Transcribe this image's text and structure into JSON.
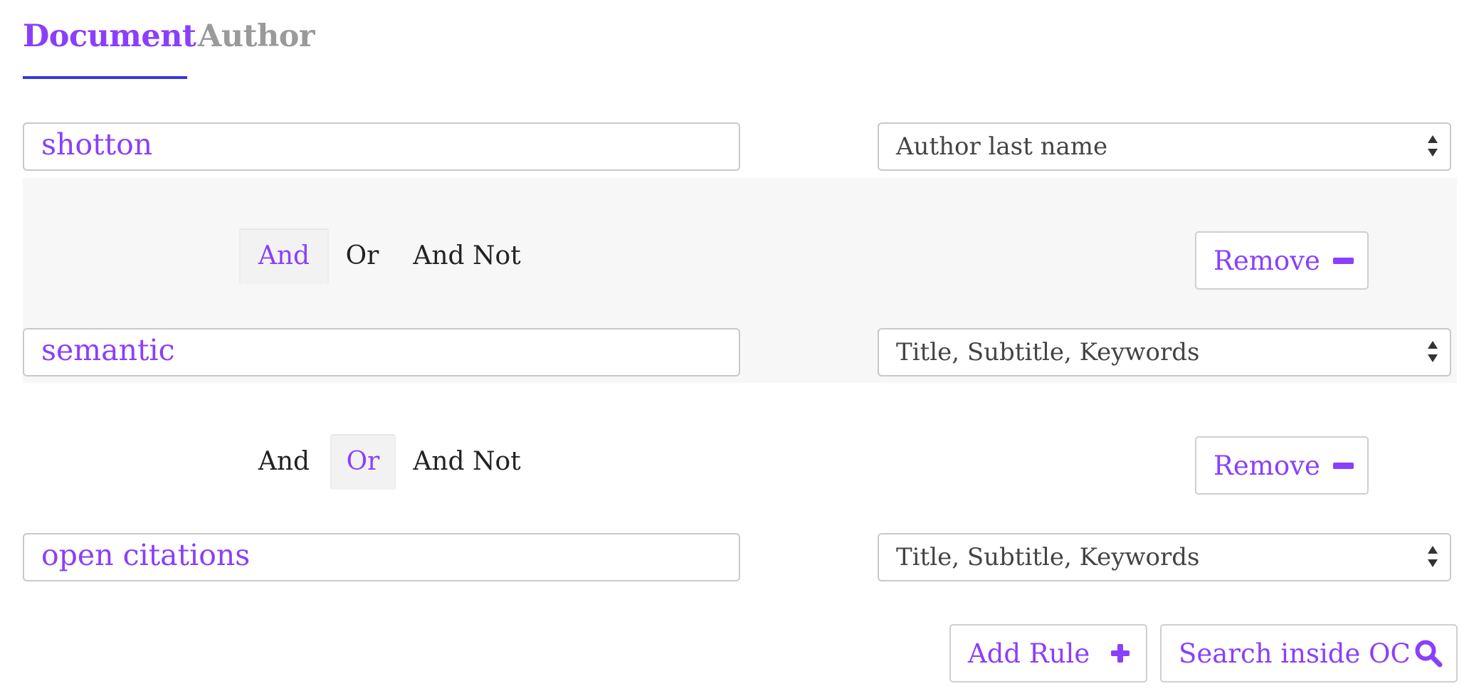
{
  "tabs": [
    {
      "label": "Document",
      "active": true
    },
    {
      "label": "Author",
      "active": false
    }
  ],
  "accent_color": "#8a3ffc",
  "rules": [
    {
      "query": "shotton",
      "field": "Author last name"
    },
    {
      "operator_options": [
        "And",
        "Or",
        "And Not"
      ],
      "operator_selected": "And",
      "remove_label": "Remove",
      "query": "semantic",
      "field": "Title, Subtitle, Keywords"
    },
    {
      "operator_options": [
        "And",
        "Or",
        "And Not"
      ],
      "operator_selected": "Or",
      "remove_label": "Remove",
      "query": "open citations",
      "field": "Title, Subtitle, Keywords"
    }
  ],
  "actions": {
    "add_rule_label": "Add Rule",
    "search_label": "Search inside OC"
  },
  "icons": {
    "remove": "minus-icon",
    "add": "plus-icon",
    "search": "search-icon",
    "select": "chevron-up-down-icon"
  }
}
